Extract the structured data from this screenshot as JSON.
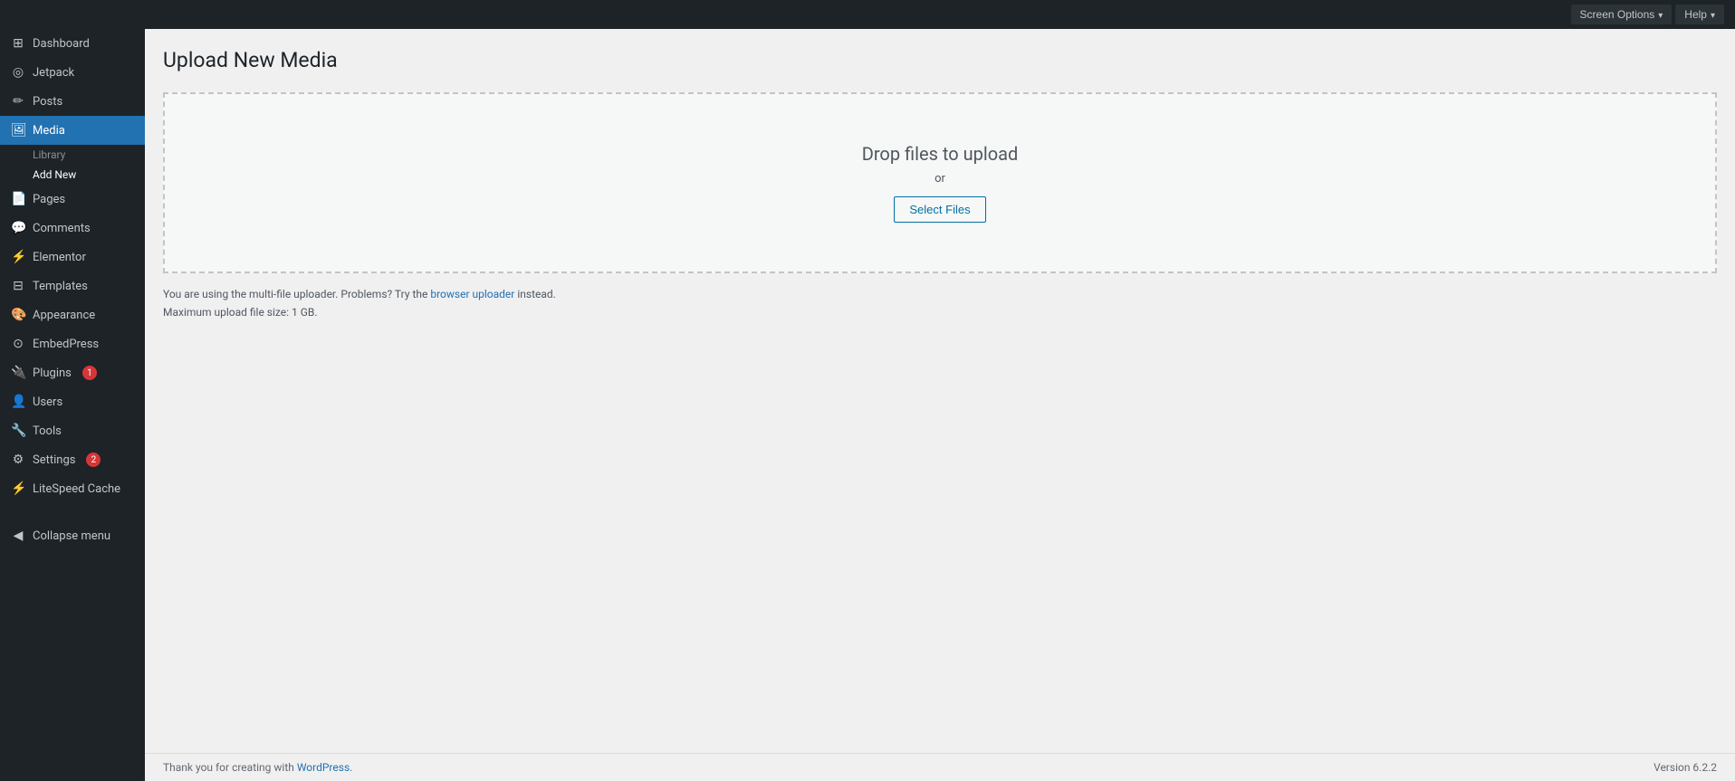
{
  "adminbar": {
    "screen_options_label": "Screen Options",
    "help_label": "Help"
  },
  "sidebar": {
    "items": [
      {
        "id": "dashboard",
        "icon": "⊞",
        "label": "Dashboard",
        "active": false
      },
      {
        "id": "jetpack",
        "icon": "⚡",
        "label": "Jetpack",
        "active": false
      },
      {
        "id": "posts",
        "icon": "📌",
        "label": "Posts",
        "active": false
      },
      {
        "id": "media",
        "icon": "🖼",
        "label": "Media",
        "active": true
      },
      {
        "id": "pages",
        "icon": "📄",
        "label": "Pages",
        "active": false
      },
      {
        "id": "comments",
        "icon": "💬",
        "label": "Comments",
        "active": false
      },
      {
        "id": "elementor",
        "icon": "⚡",
        "label": "Elementor",
        "active": false
      },
      {
        "id": "templates",
        "icon": "⊟",
        "label": "Templates",
        "active": false
      },
      {
        "id": "appearance",
        "icon": "🎨",
        "label": "Appearance",
        "active": false
      },
      {
        "id": "embedpress",
        "icon": "⊙",
        "label": "EmbedPress",
        "active": false
      },
      {
        "id": "plugins",
        "icon": "🔌",
        "label": "Plugins",
        "badge": "1",
        "active": false
      },
      {
        "id": "users",
        "icon": "👤",
        "label": "Users",
        "active": false
      },
      {
        "id": "tools",
        "icon": "🔧",
        "label": "Tools",
        "active": false
      },
      {
        "id": "settings",
        "icon": "⚙",
        "label": "Settings",
        "badge": "2",
        "active": false
      },
      {
        "id": "litespeed",
        "icon": "⚡",
        "label": "LiteSpeed Cache",
        "active": false
      }
    ],
    "media_sub": [
      {
        "id": "library",
        "label": "Library",
        "active": false
      },
      {
        "id": "add-new",
        "label": "Add New",
        "active": true
      }
    ],
    "collapse_label": "Collapse menu"
  },
  "page": {
    "title": "Upload New Media"
  },
  "upload": {
    "drop_text": "Drop files to upload",
    "or_text": "or",
    "select_files_label": "Select Files",
    "note_text": "You are using the multi-file uploader. Problems? Try the",
    "browser_uploader_link": "browser uploader",
    "note_suffix": " instead.",
    "max_upload_text": "Maximum upload file size: 1 GB."
  },
  "footer": {
    "thank_you_text": "Thank you for creating with ",
    "wordpress_link_text": "WordPress",
    "version_text": "Version 6.2.2"
  }
}
